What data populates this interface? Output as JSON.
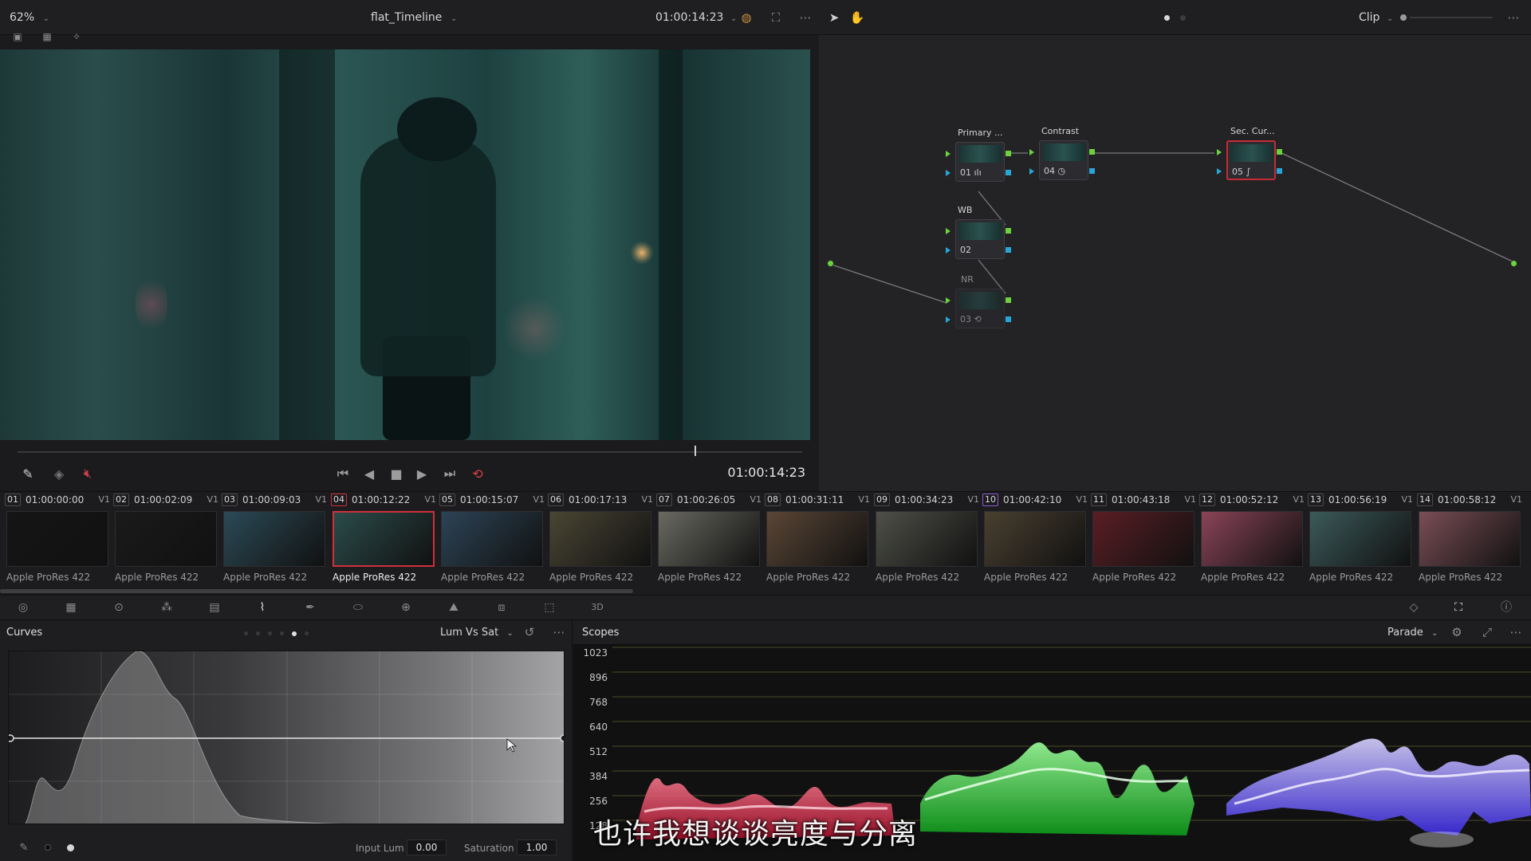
{
  "topbar": {
    "zoom": "62%",
    "timeline_name": "flat_Timeline",
    "timecode": "01:00:14:23",
    "clip_mode": "Clip"
  },
  "viewer": {
    "current_timecode": "01:00:14:23"
  },
  "nodes": [
    {
      "label": "Primary ...",
      "num": "01",
      "glyph": "ılı"
    },
    {
      "label": "WB",
      "num": "02",
      "glyph": ""
    },
    {
      "label": "NR",
      "num": "03",
      "glyph": "⟲"
    },
    {
      "label": "Contrast",
      "num": "04",
      "glyph": "◷"
    },
    {
      "label": "Sec. Cur...",
      "num": "05",
      "glyph": "∫"
    }
  ],
  "clips": [
    {
      "index": "01",
      "timecode": "01:00:00:00",
      "track": "V1",
      "codec": "Apple ProRes 422",
      "thumb": "#151515"
    },
    {
      "index": "02",
      "timecode": "01:00:02:09",
      "track": "V1",
      "codec": "Apple ProRes 422",
      "thumb": "#1a1a1a"
    },
    {
      "index": "03",
      "timecode": "01:00:09:03",
      "track": "V1",
      "codec": "Apple ProRes 422",
      "thumb": "#2b4a56"
    },
    {
      "index": "04",
      "timecode": "01:00:12:22",
      "track": "V1",
      "codec": "Apple ProRes 422",
      "thumb": "#2a4c4a"
    },
    {
      "index": "05",
      "timecode": "01:00:15:07",
      "track": "V1",
      "codec": "Apple ProRes 422",
      "thumb": "#2c4456"
    },
    {
      "index": "06",
      "timecode": "01:00:17:13",
      "track": "V1",
      "codec": "Apple ProRes 422",
      "thumb": "#4a4634"
    },
    {
      "index": "07",
      "timecode": "01:00:26:05",
      "track": "V1",
      "codec": "Apple ProRes 422",
      "thumb": "#6a6a62"
    },
    {
      "index": "08",
      "timecode": "01:00:31:11",
      "track": "V1",
      "codec": "Apple ProRes 422",
      "thumb": "#5a4636"
    },
    {
      "index": "09",
      "timecode": "01:00:34:23",
      "track": "V1",
      "codec": "Apple ProRes 422",
      "thumb": "#4e5048"
    },
    {
      "index": "10",
      "timecode": "01:00:42:10",
      "track": "V1",
      "codec": "Apple ProRes 422",
      "thumb": "#4a4030"
    },
    {
      "index": "11",
      "timecode": "01:00:43:18",
      "track": "V1",
      "codec": "Apple ProRes 422",
      "thumb": "#5a1e24"
    },
    {
      "index": "12",
      "timecode": "01:00:52:12",
      "track": "V1",
      "codec": "Apple ProRes 422",
      "thumb": "#8a4458"
    },
    {
      "index": "13",
      "timecode": "01:00:56:19",
      "track": "V1",
      "codec": "Apple ProRes 422",
      "thumb": "#3c5a5a"
    },
    {
      "index": "14",
      "timecode": "01:00:58:12",
      "track": "V1",
      "codec": "Apple ProRes 422",
      "thumb": "#7a4e56"
    }
  ],
  "curves": {
    "title": "Curves",
    "mode": "Lum Vs Sat",
    "input_lum_label": "Input Lum",
    "input_lum_value": "0.00",
    "saturation_label": "Saturation",
    "saturation_value": "1.00"
  },
  "scopes": {
    "title": "Scopes",
    "mode": "Parade",
    "ticks": [
      "1023",
      "896",
      "768",
      "640",
      "512",
      "384",
      "256",
      "128"
    ]
  },
  "subtitle": "也许我想谈谈亮度与分离",
  "colors": {
    "selection": "#d0303c",
    "node_output": "#6ad33d",
    "node_key": "#29a6d8",
    "clip10_badge": "#8b5bd6"
  }
}
